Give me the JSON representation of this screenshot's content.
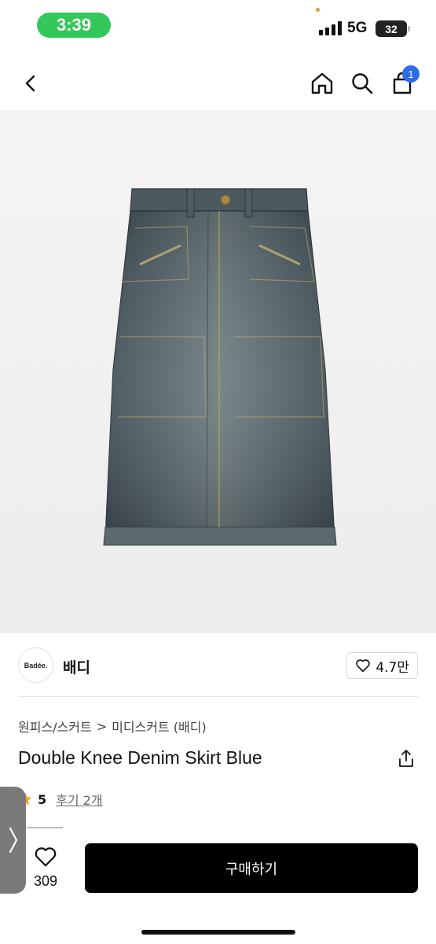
{
  "status": {
    "time": "3:39",
    "network": "5G",
    "battery": "32"
  },
  "nav": {
    "cart_count": "1"
  },
  "brand": {
    "logo_text": "Badée.",
    "name": "배디",
    "likes": "4.7만"
  },
  "breadcrumb": {
    "category": "원피스/스커트",
    "separator": ">",
    "subcategory": "미디스커트 (배디)"
  },
  "product": {
    "title": "Double Knee Denim Skirt Blue",
    "rating": "5",
    "reviews": "후기 2개"
  },
  "bottom_bar": {
    "wish_count": "309",
    "buy_label": "구매하기"
  },
  "colors": {
    "accent": "#2c6de8",
    "status_pill": "#34c759",
    "star": "#f5a623",
    "denim": "#4c5a62"
  }
}
